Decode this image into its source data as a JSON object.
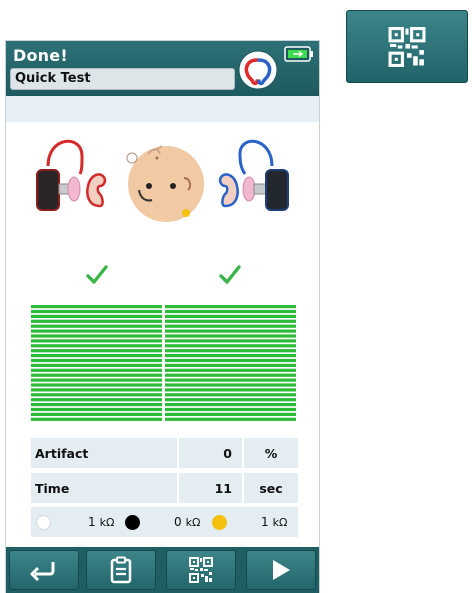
{
  "header": {
    "title": "Done!",
    "test_name": "Quick Test"
  },
  "colors": {
    "teal": "#1d5a5f",
    "pass_green": "#3ab54a",
    "bar_green": "#2dbb3a"
  },
  "results": {
    "left_status": "pass",
    "right_status": "pass",
    "icons": {
      "left": "check-icon",
      "right": "check-icon"
    }
  },
  "stats": [
    {
      "label": "Artifact",
      "value": "0",
      "unit": "%"
    },
    {
      "label": "Time",
      "value": "11",
      "unit": "sec"
    }
  ],
  "impedance": [
    {
      "value": "1",
      "unit": "kΩ",
      "electrode": "white"
    },
    {
      "value": "0",
      "unit": "kΩ",
      "electrode": "black"
    },
    {
      "value": "1",
      "unit": "kΩ",
      "electrode": "yellow"
    }
  ],
  "toolbar": {
    "icons": [
      "return-icon",
      "clipboard-icon",
      "qr-code-icon",
      "play-icon"
    ]
  },
  "side_button": {
    "icon": "qr-code-icon"
  }
}
